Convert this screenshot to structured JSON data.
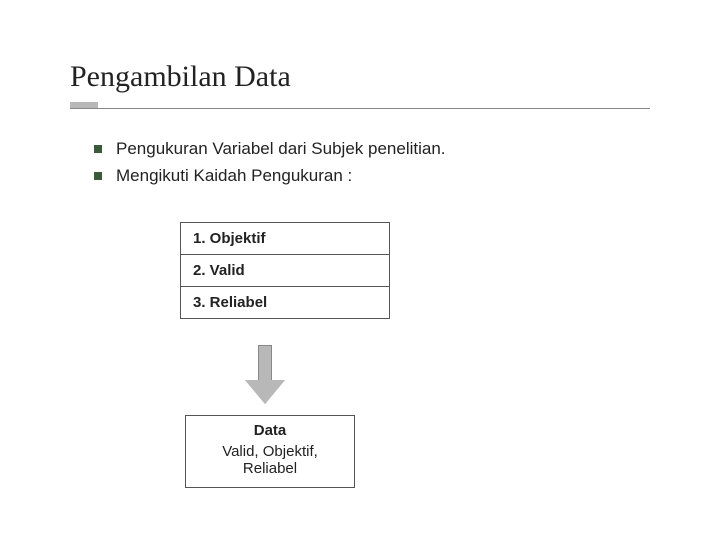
{
  "title": "Pengambilan Data",
  "bullets": [
    "Pengukuran Variabel dari Subjek penelitian.",
    "Mengikuti Kaidah Pengukuran :"
  ],
  "rules": [
    "1.  Objektif",
    "2.  Valid",
    "3.  Reliabel"
  ],
  "result": {
    "heading": "Data",
    "sub": "Valid, Objektif, Reliabel"
  }
}
